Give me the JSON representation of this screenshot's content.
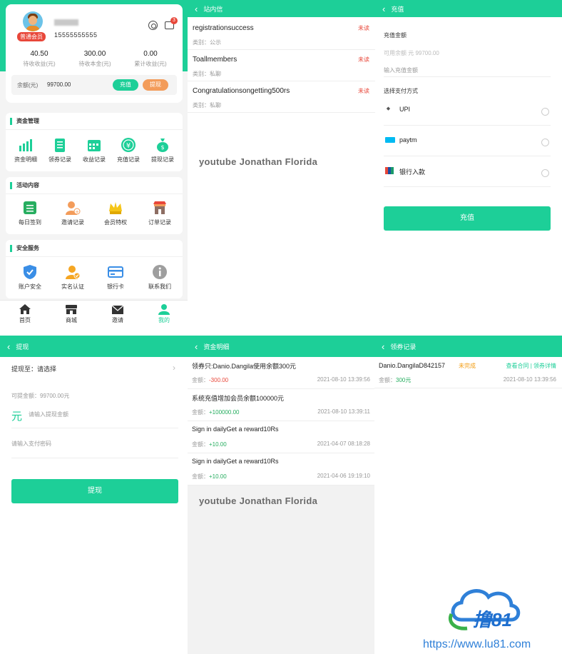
{
  "profile": {
    "member_badge": "普通会员",
    "phone": "15555555555",
    "msg_count": "3",
    "stats": [
      {
        "value": "40.50",
        "label": "待收收益(元)"
      },
      {
        "value": "300.00",
        "label": "待收本金(元)"
      },
      {
        "value": "0.00",
        "label": "累计收益(元)"
      }
    ],
    "balance_label": "余额(元)",
    "balance_value": "99700.00",
    "recharge_btn": "充值",
    "withdraw_btn": "提现",
    "sections": [
      {
        "title": "资金管理",
        "items": [
          "资金明细",
          "领券记录",
          "收益记录",
          "充值记录",
          "提现记录"
        ]
      },
      {
        "title": "活动内容",
        "items": [
          "每日签到",
          "邀请记录",
          "会员特权",
          "订单记录"
        ]
      },
      {
        "title": "安全服务",
        "items": [
          "账户安全",
          "实名认证",
          "银行卡",
          "联系我们"
        ]
      }
    ],
    "tabs": [
      "首页",
      "商城",
      "邀请",
      "我的"
    ]
  },
  "messages": {
    "title": "站内信",
    "items": [
      {
        "title": "registrationsuccess",
        "status": "未读",
        "category": "类别：公示"
      },
      {
        "title": "Toallmembers",
        "status": "未读",
        "category": "类别：私聊"
      },
      {
        "title": "Congratulationsongetting500rs",
        "status": "未读",
        "category": "类别：私聊"
      }
    ],
    "watermark": "youtube Jonathan Florida"
  },
  "recharge": {
    "title": "充值",
    "amount_label": "充值金额",
    "available": "可用余额 元 99700.00",
    "input_placeholder": "输入充值金额",
    "method_label": "选择支付方式",
    "methods": [
      "UPI",
      "paytm",
      "银行入款"
    ],
    "submit": "充值"
  },
  "withdraw": {
    "title": "提现",
    "to_label": "提现至：请选择",
    "available": "可提金额：99700.00元",
    "currency": "元",
    "amount_placeholder": "请输入提现金额",
    "pwd_placeholder": "请输入支付密码",
    "submit": "提现"
  },
  "funds": {
    "title": "资金明细",
    "items": [
      {
        "title": "领券只:Danio.Dangila使用余额300元",
        "amount_label": "金额：",
        "amount": "-300.00",
        "date": "2021-08-10 13:39:56"
      },
      {
        "title": "系统充值增加会员余额100000元",
        "amount_label": "金额：",
        "amount": "+100000.00",
        "date": "2021-08-10 13:39:11"
      },
      {
        "title": "Sign in dailyGet a reward10Rs",
        "amount_label": "金额：",
        "amount": "+10.00",
        "date": "2021-04-07 08:18:28"
      },
      {
        "title": "Sign in dailyGet a reward10Rs",
        "amount_label": "金额：",
        "amount": "+10.00",
        "date": "2021-04-06 19:19:10"
      }
    ],
    "watermark": "youtube Jonathan Florida"
  },
  "coupons": {
    "title": "领券记录",
    "item": {
      "name": "Danio.DangilaD842157",
      "status": "未完成",
      "contract_link": "查看合同",
      "sep": "|",
      "detail_link": "领券详情",
      "amount_label": "金额：",
      "amount": "300元",
      "date": "2021-08-10 13:39:56"
    }
  },
  "logo": {
    "brand": "撸81",
    "url": "https://www.lu81.com"
  },
  "colors": {
    "accent": "#1dcf98",
    "red": "#e8473a",
    "orange": "#f39c5a"
  }
}
